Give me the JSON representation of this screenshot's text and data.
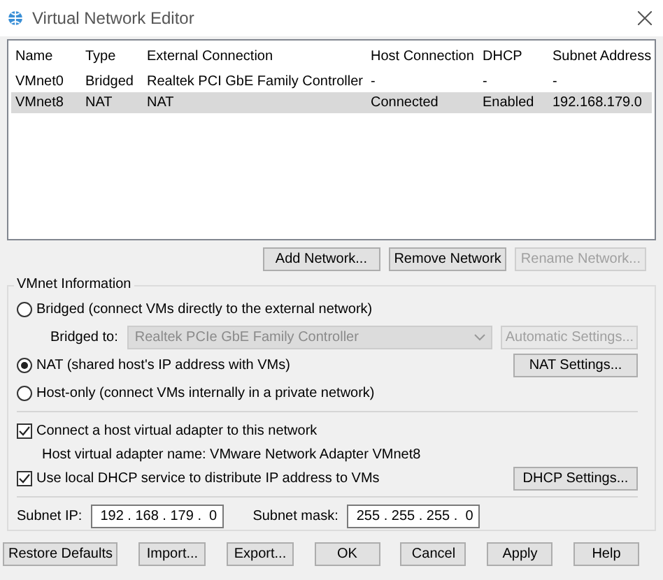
{
  "window": {
    "title": "Virtual Network Editor"
  },
  "table": {
    "columns": [
      "Name",
      "Type",
      "External Connection",
      "Host Connection",
      "DHCP",
      "Subnet Address"
    ],
    "rows": [
      {
        "cells": [
          "VMnet0",
          "Bridged",
          "Realtek PCI GbE Family Controller",
          "-",
          "-",
          "-"
        ],
        "selected": false
      },
      {
        "cells": [
          "VMnet8",
          "NAT",
          "NAT",
          "Connected",
          "Enabled",
          "192.168.179.0"
        ],
        "selected": true
      }
    ]
  },
  "network_buttons": [
    {
      "label": "Add Network...",
      "disabled": false
    },
    {
      "label": "Remove Network",
      "disabled": false
    },
    {
      "label": "Rename Network...",
      "disabled": true
    }
  ],
  "vmnet_info": {
    "title": "VMnet Information",
    "modes": [
      {
        "label": "Bridged (connect VMs directly to the external network)",
        "selected": false
      },
      {
        "label": "NAT (shared host's IP address with VMs)",
        "selected": true
      },
      {
        "label": "Host-only (connect VMs internally in a private network)",
        "selected": false
      }
    ],
    "bridged_to": {
      "label": "Bridged to:",
      "value": "Realtek PCIe GbE Family Controller",
      "disabled": true
    },
    "automatic_settings": {
      "label": "Automatic Settings...",
      "disabled": true
    },
    "nat_settings": {
      "label": "NAT Settings...",
      "disabled": false
    },
    "host_adapter": {
      "label": "Connect a host virtual adapter to this network",
      "checked": true
    },
    "adapter_name": "Host virtual adapter name: VMware Network Adapter VMnet8",
    "dhcp": {
      "label": "Use local DHCP service to distribute IP address to VMs",
      "checked": true
    },
    "dhcp_settings": {
      "label": "DHCP Settings...",
      "disabled": false
    },
    "subnet_ip": {
      "label": "Subnet IP:",
      "value": "192 . 168 . 179 .  0"
    },
    "subnet_mask": {
      "label": "Subnet mask:",
      "value": "255 . 255 . 255 .  0"
    }
  },
  "footer_buttons": [
    {
      "label": "Restore Defaults",
      "disabled": false
    },
    {
      "label": "Import...",
      "disabled": false
    },
    {
      "label": "Export...",
      "disabled": false
    },
    {
      "label": "OK",
      "disabled": false
    },
    {
      "label": "Cancel",
      "disabled": false
    },
    {
      "label": "Apply",
      "disabled": false
    },
    {
      "label": "Help",
      "disabled": false
    }
  ]
}
